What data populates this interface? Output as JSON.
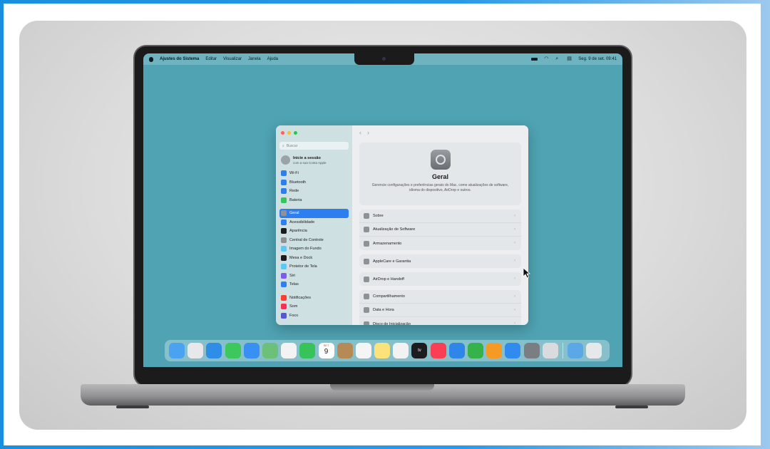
{
  "menubar": {
    "app_name": "Ajustes do Sistema",
    "menus": [
      "Editar",
      "Visualizar",
      "Janela",
      "Ajuda"
    ],
    "clock": "Seg. 9 de set.  09:41"
  },
  "sidebar": {
    "search_placeholder": "Buscar",
    "account_title": "Inicie a sessão",
    "account_subtitle": "com a sua Conta Apple",
    "groups": [
      [
        {
          "label": "Wi-Fi",
          "color": "#2d7ff0"
        },
        {
          "label": "Bluetooth",
          "color": "#2d7ff0"
        },
        {
          "label": "Rede",
          "color": "#2d7ff0"
        },
        {
          "label": "Bateria",
          "color": "#34c759"
        }
      ],
      [
        {
          "label": "Geral",
          "color": "#8e9296",
          "active": true
        },
        {
          "label": "Acessibilidade",
          "color": "#2d7ff0"
        },
        {
          "label": "Aparência",
          "color": "#1c1c1e"
        },
        {
          "label": "Central de Controle",
          "color": "#8e9296"
        },
        {
          "label": "Imagem do Fundo",
          "color": "#5ac8fa"
        },
        {
          "label": "Mesa e Dock",
          "color": "#1c1c1e"
        },
        {
          "label": "Protetor de Tela",
          "color": "#5ac8fa"
        },
        {
          "label": "Siri",
          "color": "#7d5cf0"
        },
        {
          "label": "Telas",
          "color": "#2d7ff0"
        }
      ],
      [
        {
          "label": "Notificações",
          "color": "#ff3b30"
        },
        {
          "label": "Som",
          "color": "#ff2d55"
        },
        {
          "label": "Foco",
          "color": "#5856d6"
        }
      ]
    ]
  },
  "content": {
    "title": "Geral",
    "description": "Gerencie configurações e preferências gerais do Mac, como atualizações de software, idioma do dispositivo, AirDrop e outros.",
    "groups": [
      [
        "Sobre",
        "Atualização de Software",
        "Armazenamento"
      ],
      [
        "AppleCare e Garantia"
      ],
      [
        "AirDrop e Handoff"
      ],
      [
        "Compartilhamento",
        "Data e Hora",
        "Disco de Inicialização"
      ]
    ]
  },
  "dock": {
    "calendar_month": "SET",
    "calendar_day": "9",
    "tv_label": "tv",
    "apps": [
      {
        "name": "finder",
        "color": "#4aa3f0"
      },
      {
        "name": "launchpad",
        "color": "#e8e8ea"
      },
      {
        "name": "safari",
        "color": "#2e8de6"
      },
      {
        "name": "messages",
        "color": "#3cc85c"
      },
      {
        "name": "mail",
        "color": "#3a8ff2"
      },
      {
        "name": "maps",
        "color": "#6dc07a"
      },
      {
        "name": "photos",
        "color": "#f3f3f3"
      },
      {
        "name": "facetime",
        "color": "#35c35a"
      },
      {
        "name": "calendar",
        "color": "#ffffff"
      },
      {
        "name": "contacts",
        "color": "#b58a55"
      },
      {
        "name": "reminders",
        "color": "#f5f5f5"
      },
      {
        "name": "notes",
        "color": "#fbe27a"
      },
      {
        "name": "freeform",
        "color": "#f2f2f2"
      },
      {
        "name": "tv",
        "color": "#1c1c1e"
      },
      {
        "name": "music",
        "color": "#fa3f55"
      },
      {
        "name": "keynote",
        "color": "#2f86e8"
      },
      {
        "name": "numbers",
        "color": "#35b24a"
      },
      {
        "name": "pages",
        "color": "#f59b24"
      },
      {
        "name": "app-store",
        "color": "#2f8bf0"
      },
      {
        "name": "system-settings",
        "color": "#7a7e83"
      },
      {
        "name": "iphone-mirroring",
        "color": "#d9dbde"
      }
    ],
    "trailing": [
      {
        "name": "downloads",
        "color": "#5aa9e6"
      },
      {
        "name": "trash",
        "color": "#e6e8ea"
      }
    ]
  }
}
